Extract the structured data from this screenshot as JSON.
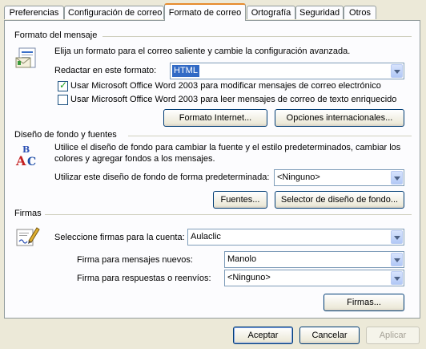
{
  "tabs": [
    {
      "label": "Preferencias"
    },
    {
      "label": "Configuración de correo"
    },
    {
      "label": "Formato de correo",
      "active": true
    },
    {
      "label": "Ortografía"
    },
    {
      "label": "Seguridad"
    },
    {
      "label": "Otros"
    }
  ],
  "message_format": {
    "heading": "Formato del mensaje",
    "description": "Elija un formato para el correo saliente y cambie la configuración avanzada.",
    "compose_label": "Redactar en este formato:",
    "compose_value": "HTML",
    "checkbox_word_edit": {
      "label": "Usar Microsoft Office Word 2003 para modificar mensajes de correo electrónico",
      "checked": true
    },
    "checkbox_word_read": {
      "label": "Usar Microsoft Office Word 2003 para leer mensajes de correo de texto enriquecido",
      "checked": false
    },
    "internet_format_button": "Formato Internet...",
    "international_options_button": "Opciones internacionales..."
  },
  "stationery": {
    "heading": "Diseño de fondo y fuentes",
    "description_line1": "Utilice el diseño de fondo para cambiar la fuente y el estilo predeterminados, cambiar los",
    "description_line2": "colores y agregar fondos a los mensajes.",
    "default_label": "Utilizar este diseño de fondo de forma predeterminada:",
    "default_value": "<Ninguno>",
    "fonts_button": "Fuentes...",
    "stationery_picker_button": "Selector de diseño de fondo..."
  },
  "signatures": {
    "heading": "Firmas",
    "account_label": "Seleccione firmas para la cuenta:",
    "account_value": "Aulaclic",
    "new_label": "Firma para mensajes nuevos:",
    "new_value": "Manolo",
    "reply_label": "Firma para respuestas o reenvíos:",
    "reply_value": "<Ninguno>",
    "signatures_button": "Firmas..."
  },
  "footer": {
    "accept": "Aceptar",
    "cancel": "Cancelar",
    "apply": "Aplicar"
  },
  "colors": {
    "dialog_bg": "#ece9d8",
    "panel_bg": "#fcfcfe",
    "selection": "#316ac5",
    "tab_accent": "#e68b2c"
  },
  "icons": {
    "format": "email-envelope-icon",
    "stationery": "abc-fonts-icon",
    "signatures": "signature-pen-icon"
  }
}
